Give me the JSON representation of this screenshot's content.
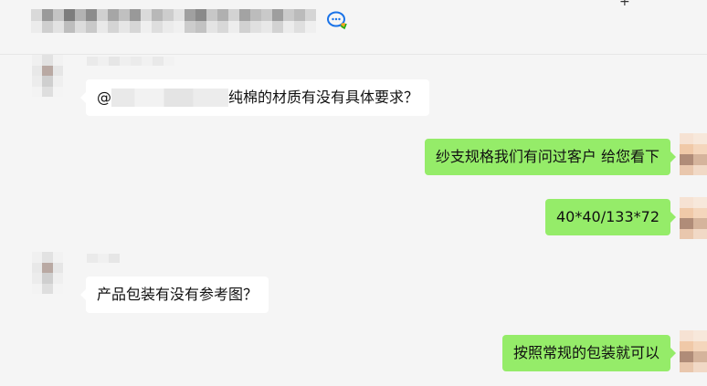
{
  "header": {
    "title_icon": "chat-bubble-icon",
    "add_icon": "plus-icon",
    "more_icon": "more-icon",
    "plus_glyph": "+",
    "more_glyph": "···"
  },
  "messages": [
    {
      "side": "in",
      "prefix": "@",
      "text": "纯棉的材质有没有具体要求？"
    },
    {
      "side": "out",
      "text": "纱支规格我们有问过客户 给您看下"
    },
    {
      "side": "out",
      "text": "40*40/133*72"
    },
    {
      "side": "in",
      "text": "产品包装有没有参考图？"
    },
    {
      "side": "out",
      "text": "按照常规的包装就可以"
    }
  ],
  "colors": {
    "background": "#f5f5f5",
    "incoming_bubble": "#ffffff",
    "outgoing_bubble": "#95ec69",
    "icon_blue": "#1a73e8"
  }
}
